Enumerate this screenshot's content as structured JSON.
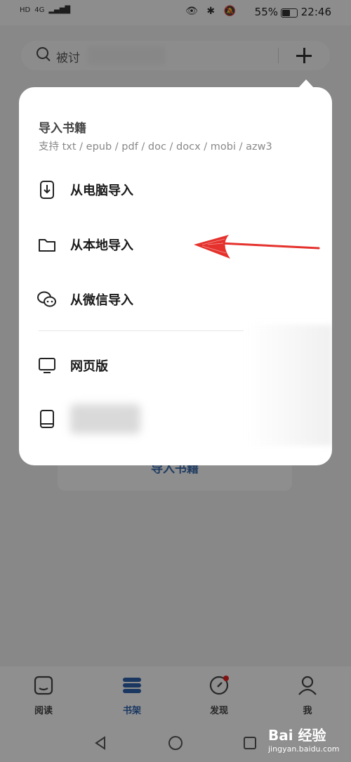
{
  "status_bar": {
    "time": "22:46",
    "battery": "55%",
    "left_tags": [
      "HD",
      "4G"
    ]
  },
  "search": {
    "placeholder": "被讨"
  },
  "background": {
    "import_button_label": "导入书籍"
  },
  "popup": {
    "title": "导入书籍",
    "subtitle": "支持 txt / epub / pdf / doc / docx / mobi / azw3",
    "items": [
      {
        "label": "从电脑导入",
        "icon": "computer-phone-icon"
      },
      {
        "label": "从本地导入",
        "icon": "folder-icon"
      },
      {
        "label": "从微信导入",
        "icon": "wechat-icon"
      },
      {
        "label": "网页版",
        "icon": "monitor-icon"
      },
      {
        "label": "",
        "icon": "tablet-icon"
      }
    ]
  },
  "tabbar": {
    "tabs": [
      {
        "label": "阅读",
        "icon": "read-icon",
        "active": false
      },
      {
        "label": "书架",
        "icon": "bookshelf-icon",
        "active": true
      },
      {
        "label": "发现",
        "icon": "compass-icon",
        "active": false
      },
      {
        "label": "我",
        "icon": "person-icon",
        "active": false
      }
    ]
  },
  "watermark": {
    "brand": "Bai 经验",
    "url": "jingyan.baidu.com"
  },
  "colors": {
    "accent": "#2b5fa8",
    "arrow": "#e5322d",
    "badge": "#e02020"
  }
}
